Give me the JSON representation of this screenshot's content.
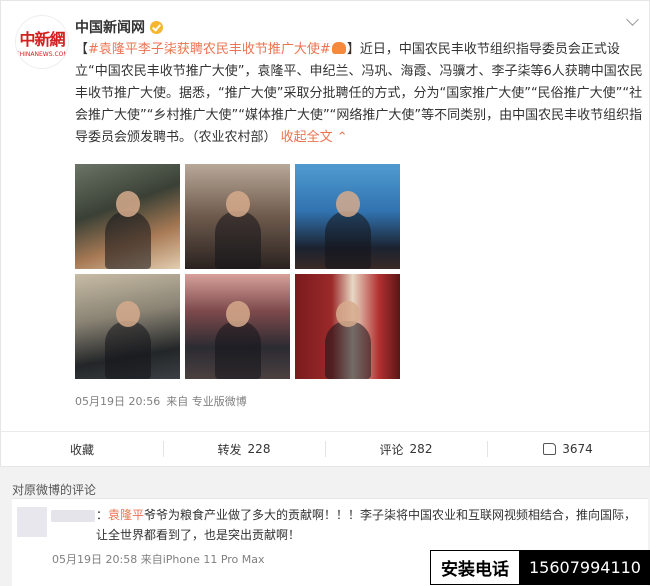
{
  "post": {
    "author": "中国新闻网",
    "avatar": {
      "logo_cn": "中新網",
      "logo_en": "CHINANEWS.COM"
    },
    "topic": "#袁隆平李子柒获聘农民丰收节推广大使#",
    "text_1": "】近日，中国农民丰收节组织指导委员会正式设立“中国农民丰收节推广大使”，袁隆平、申纪兰、冯巩、海霞、冯骥才、李子柒等6人获聘中国农民丰收节推广大使。据悉，“推广大使”采取分批聘任的方式，分为“国家推广大使”“民俗推广大使”“社会推广大使”“乡村推广大使”“媒体推广大使”“网络推广大使”等不同类别，由中国农民丰收节组织指导委员会颁发聘书。（农业农村部）",
    "bracket_open": "【",
    "collapse_link": "收起全文 ⌃",
    "time": "05月19日 20:56",
    "source": "来自 专业版微博",
    "photos": [
      "photo-1",
      "photo-2",
      "photo-3",
      "photo-4",
      "photo-5",
      "photo-6"
    ]
  },
  "actions": {
    "favorite": "收藏",
    "repost_label": "转发",
    "repost_count": "228",
    "comment_label": "评论",
    "comment_count": "282",
    "like_count": "3674"
  },
  "comments": {
    "header": "对原微博的评论",
    "items": [
      {
        "mention": "袁隆平",
        "prefix": "：",
        "text": "爷爷为粮食产业做了多大的贡献啊！！！李子柒将中国农业和互联网视频相结合，推向国际，让全世界都看到了，也是突出贡献啊！",
        "time": "05月19日 20:58",
        "source": "来自iPhone 11 Pro Max"
      }
    ]
  },
  "promo": {
    "label": "安装电话",
    "phone": "15607994110"
  },
  "colors": {
    "accent": "#eb7350",
    "verified": "#f8b62d",
    "logo": "#d21f1f"
  }
}
